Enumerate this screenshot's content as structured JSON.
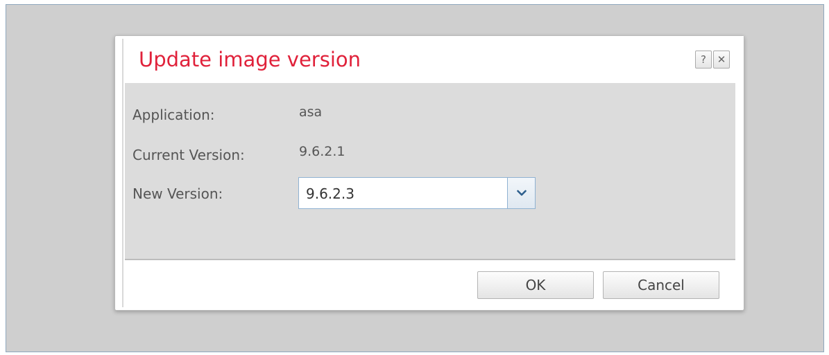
{
  "dialog": {
    "title": "Update image version",
    "help_label": "?",
    "close_label": "✕"
  },
  "fields": {
    "application_label": "Application:",
    "application_value": "asa",
    "current_version_label": "Current Version:",
    "current_version_value": "9.6.2.1",
    "new_version_label": "New Version:",
    "new_version_selected": "9.6.2.3"
  },
  "footer": {
    "ok_label": "OK",
    "cancel_label": "Cancel"
  },
  "colors": {
    "title": "#e0213a",
    "backdrop": "#cfcfcf",
    "content_bg": "#dcdcdc",
    "select_border": "#8fb2d2"
  },
  "icons": {
    "help": "question-mark-icon",
    "close": "close-icon",
    "dropdown": "chevron-down-icon"
  }
}
